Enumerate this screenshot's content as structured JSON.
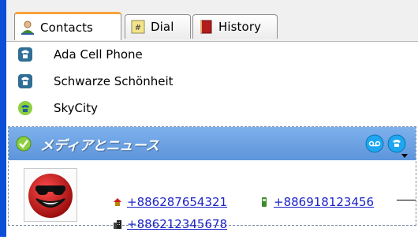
{
  "tabs": [
    {
      "label": "Contacts",
      "icon": "contacts-icon",
      "active": true
    },
    {
      "label": "Dial",
      "icon": "dialpad-icon",
      "active": false
    },
    {
      "label": "History",
      "icon": "history-book-icon",
      "active": false
    }
  ],
  "contacts": [
    {
      "name": "Ada Cell Phone",
      "icon": "phone-contact-icon"
    },
    {
      "name": "Schwarze Schönheit",
      "icon": "phone-contact-icon"
    },
    {
      "name": "SkyCity",
      "icon": "skype-online-icon"
    }
  ],
  "selected_contact": {
    "name": "メディアとニュース",
    "status_icon": "online-check-icon",
    "phones": {
      "home": "+886287654321",
      "mobile": "+886918123456",
      "office": "+886212345678"
    }
  },
  "colors": {
    "header_blue": "#6ea3e6",
    "link_blue": "#1d25c5",
    "active_tab_accent": "#f8a33a",
    "window_edge": "#0a4fd6"
  }
}
